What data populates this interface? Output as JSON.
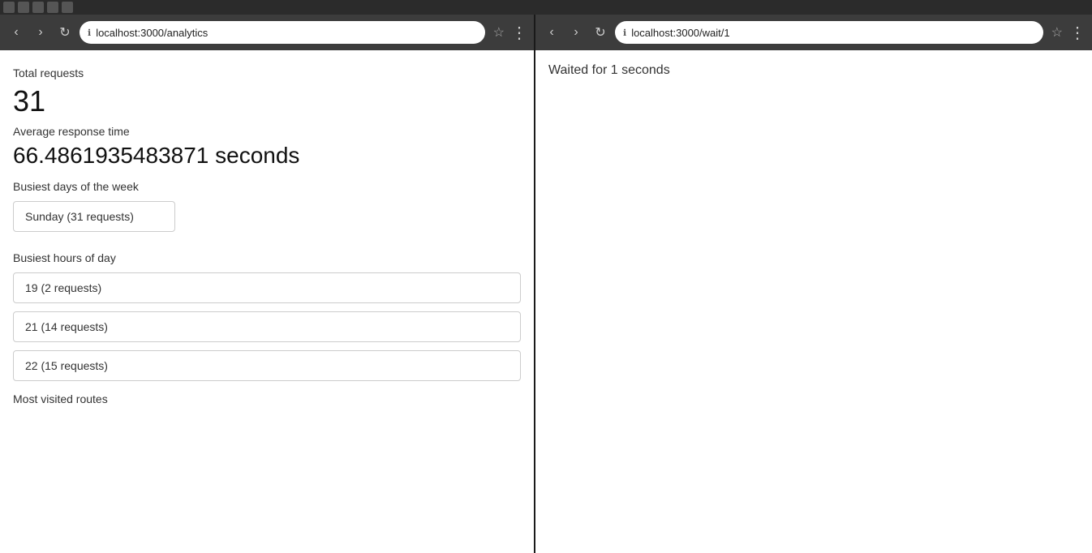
{
  "taskbar": {
    "visible": true
  },
  "left_browser": {
    "url": "localhost:3000/analytics",
    "back_btn": "‹",
    "forward_btn": "›",
    "reload_btn": "↻",
    "star": "☆",
    "menu": "⋮",
    "page": {
      "total_requests_label": "Total requests",
      "total_requests_value": "31",
      "avg_response_label": "Average response time",
      "avg_response_value": "66.4861935483871 seconds",
      "busiest_days_label": "Busiest days of the week",
      "busiest_days_items": [
        "Sunday (31 requests)"
      ],
      "busiest_hours_label": "Busiest hours of day",
      "busiest_hours_items": [
        "19 (2 requests)",
        "21 (14 requests)",
        "22 (15 requests)"
      ],
      "most_visited_label": "Most visited routes"
    }
  },
  "right_browser": {
    "url": "localhost:3000/wait/1",
    "back_btn": "‹",
    "forward_btn": "›",
    "reload_btn": "↻",
    "star": "☆",
    "menu": "⋮",
    "page": {
      "wait_message": "Waited for 1 seconds"
    }
  }
}
